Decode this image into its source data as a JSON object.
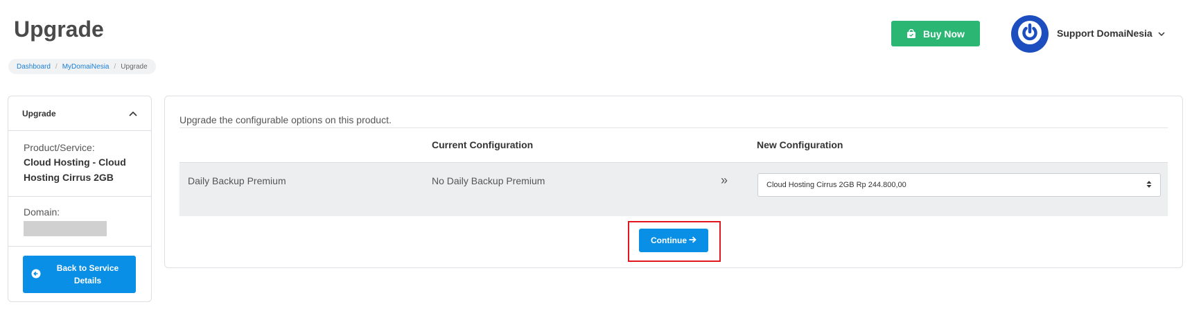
{
  "header": {
    "title": "Upgrade",
    "buy_now_label": "Buy Now",
    "user_name": "Support DomaiNesia"
  },
  "breadcrumb": {
    "items": [
      "Dashboard",
      "MyDomaiNesia",
      "Upgrade"
    ],
    "separator": "/"
  },
  "sidebar": {
    "header": "Upgrade",
    "product_label": "Product/Service:",
    "product_value": "Cloud Hosting - Cloud Hosting Cirrus 2GB",
    "domain_label": "Domain:",
    "back_button": "Back to Service Details"
  },
  "main": {
    "intro": "Upgrade the configurable options on this product.",
    "columns": [
      "",
      "Current Configuration",
      "New Configuration"
    ],
    "rows": [
      {
        "option": "Daily Backup Premium",
        "current": "No Daily Backup Premium",
        "arrow": "»",
        "new_value": "Cloud Hosting Cirrus 2GB Rp 244.800,00"
      }
    ],
    "continue_label": "Continue"
  },
  "colors": {
    "primary": "#0a8fe6",
    "success": "#2bb673",
    "avatar": "#1d4ec0",
    "highlight": "#e0161e"
  }
}
